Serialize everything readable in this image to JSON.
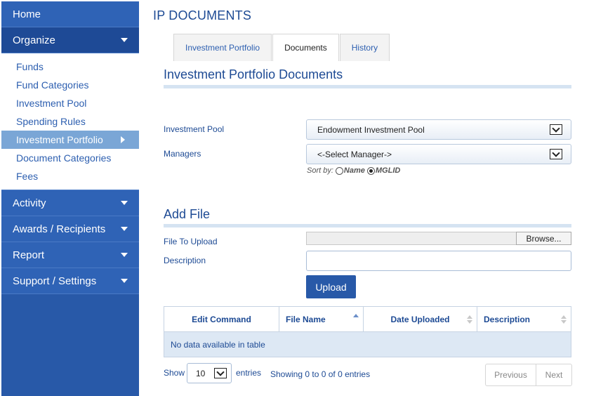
{
  "sidebar": {
    "home": "Home",
    "organize": "Organize",
    "organize_items": [
      "Funds",
      "Fund Categories",
      "Investment Pool",
      "Spending Rules",
      "Investment Portfolio",
      "Document Categories",
      "Fees"
    ],
    "activity": "Activity",
    "awards": "Awards / Recipients",
    "report": "Report",
    "support": "Support / Settings"
  },
  "page": {
    "title": "IP DOCUMENTS"
  },
  "tabs": [
    "Investment Portfolio",
    "Documents",
    "History"
  ],
  "documents": {
    "section_title": "Investment Portfolio Documents",
    "pool_label": "Investment Pool",
    "pool_value": "Endowment Investment Pool",
    "managers_label": "Managers",
    "managers_value": "<-Select Manager->",
    "sort_by": "Sort by:",
    "sort_name": "Name",
    "sort_mglid": "MGLID"
  },
  "add_file": {
    "title": "Add File",
    "file_label": "File To Upload",
    "browse": "Browse...",
    "desc_label": "Description",
    "upload": "Upload"
  },
  "table": {
    "columns": [
      "Edit Command",
      "File Name",
      "Date Uploaded",
      "Description"
    ],
    "empty": "No data available in table",
    "show": "Show",
    "length": "10",
    "entries": "entries",
    "info": "Showing 0 to 0 of 0 entries",
    "previous": "Previous",
    "next": "Next"
  }
}
